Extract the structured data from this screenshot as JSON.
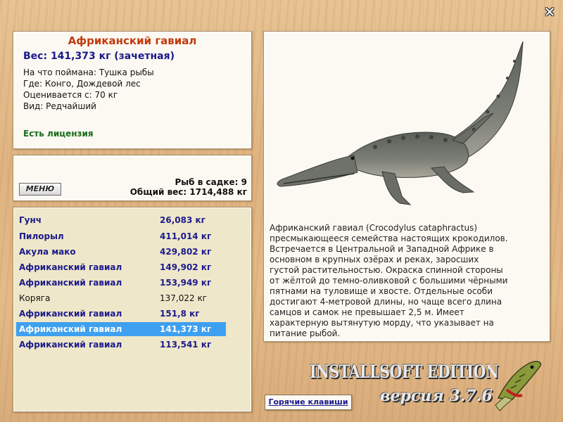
{
  "window": {
    "close_symbol": "✕"
  },
  "info": {
    "title": "Африканский гавиал",
    "weight": "Вес: 141,373 кг (зачетная)",
    "lines": [
      "На что поймана: Тушка рыбы",
      "Где: Конго, Дождевой лес",
      "Оценивается с: 70 кг",
      "Вид: Редчайший"
    ],
    "license": "Есть лицензия"
  },
  "cage": {
    "menu_label": "МЕНЮ",
    "count_text": "Рыб в садке: 9",
    "total_text": "Общий вес: 1714,488 кг"
  },
  "catch_list": [
    {
      "name": "Гунч",
      "weight": "26,083 кг",
      "style": "bold"
    },
    {
      "name": "Пилорыл",
      "weight": "411,014 кг",
      "style": "bold"
    },
    {
      "name": "Акула мако",
      "weight": "429,802 кг",
      "style": "bold"
    },
    {
      "name": "Африканский гавиал",
      "weight": "149,902 кг",
      "style": "bold"
    },
    {
      "name": "Африканский гавиал",
      "weight": "153,949 кг",
      "style": "bold"
    },
    {
      "name": "Коряга",
      "weight": "137,022 кг",
      "style": "normal"
    },
    {
      "name": "Африканский гавиал",
      "weight": "151,8 кг",
      "style": "bold"
    },
    {
      "name": "Африканский гавиал",
      "weight": "141,373 кг",
      "style": "selected"
    },
    {
      "name": "Африканский гавиал",
      "weight": "113,541 кг",
      "style": "bold"
    }
  ],
  "picture": {
    "icon": "crocodile-icon"
  },
  "description": "Африканский гавиал (Crocodylus cataphractus) пресмыкающееся семейства настоящих крокодилов. Встречается в Центральной и Западной Африке в основном в крупных озёрах и реках, заросших густой растительностью. Окраска спинной стороны от жёлтой до темно-оливковой с большими чёрными пятнами на туловище и хвосте. Отдельные особи достигают 4-метровой длины, но чаще всего длина самцов и самок не превышает 2,5 м. Имеет характерную вытянутую морду, что указывает на питание рыбой.",
  "hotkeys_label": "Горячие клавиши",
  "branding": {
    "title": "INSTALLSOFT EDITION",
    "version": "версия 3.7.6",
    "logo_icon": "pike-icon"
  }
}
